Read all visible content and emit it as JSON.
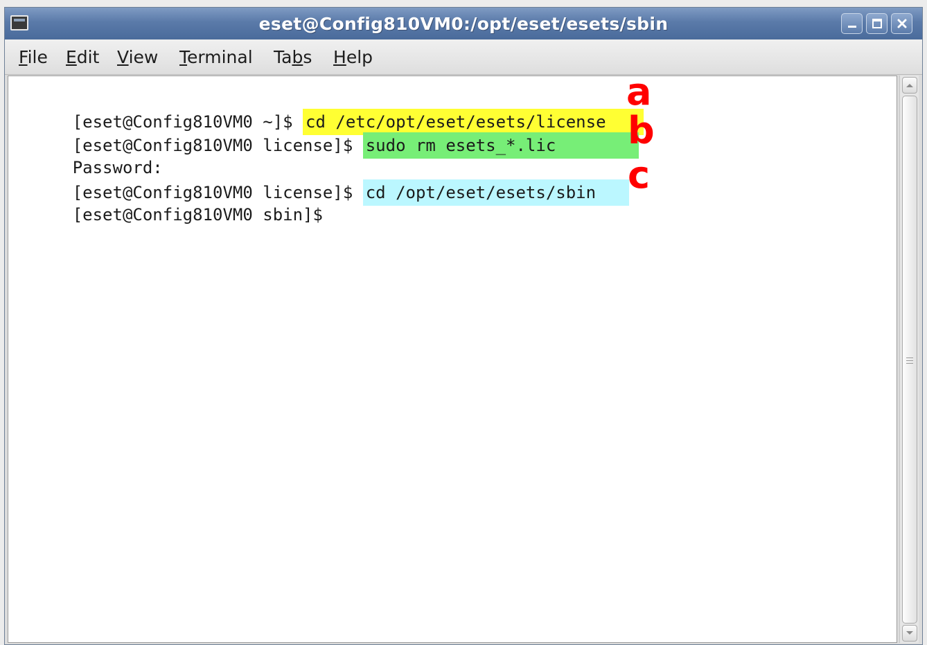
{
  "window": {
    "title": "eset@Config810VM0:/opt/eset/esets/sbin"
  },
  "menubar": {
    "items": [
      "File",
      "Edit",
      "View",
      "Terminal",
      "Tabs",
      "Help"
    ],
    "mnemonics": [
      "F",
      "E",
      "V",
      "T",
      "b",
      "H"
    ]
  },
  "terminal": {
    "lines": [
      {
        "prompt": "[eset@Config810VM0 ~]$ ",
        "command": "cd /etc/opt/eset/esets/license",
        "highlight": "#ffff33"
      },
      {
        "prompt": "[eset@Config810VM0 license]$ ",
        "command": "sudo rm esets_*.lic",
        "highlight": "#77ee77"
      },
      {
        "prompt": "Password:",
        "command": "",
        "highlight": ""
      },
      {
        "prompt": "[eset@Config810VM0 license]$ ",
        "command": "cd /opt/eset/esets/sbin",
        "highlight": "#bbf7ff"
      },
      {
        "prompt": "[eset@Config810VM0 sbin]$",
        "command": "",
        "highlight": ""
      }
    ]
  },
  "annotations": [
    "a",
    "b",
    "c"
  ],
  "colors": {
    "annotation": "#ff0000",
    "titlebar": "#5a7aa9"
  }
}
